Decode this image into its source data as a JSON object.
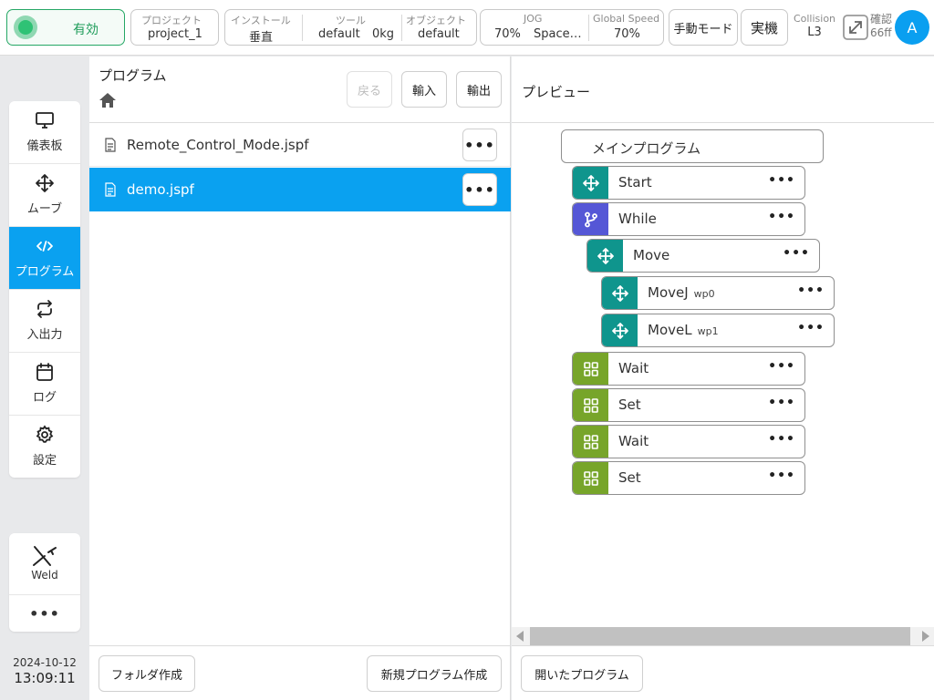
{
  "topbar": {
    "enable": {
      "label": "有効"
    },
    "project": {
      "label": "プロジェクト",
      "value": "project_1"
    },
    "install": {
      "label": "インストール",
      "value": "垂直"
    },
    "tool": {
      "label": "ツール",
      "name": "default",
      "weight": "0kg"
    },
    "object": {
      "label": "オブジェクト",
      "value": "default"
    },
    "jog": {
      "label": "JOG",
      "percent": "70%",
      "space": "Space…"
    },
    "global_speed": {
      "label": "Global Speed",
      "value": "70%"
    },
    "manual_mode": "手動モード",
    "real_machine": "実機",
    "collision": {
      "label": "Collision",
      "value": "L3"
    },
    "confirm": {
      "label": "確認",
      "value": "66ff"
    },
    "avatar": "A"
  },
  "nav": {
    "items": [
      {
        "label": "儀表板",
        "icon": "monitor-icon"
      },
      {
        "label": "ムーブ",
        "icon": "move-icon"
      },
      {
        "label": "プログラム",
        "icon": "code-icon",
        "active": true
      },
      {
        "label": "入出力",
        "icon": "swap-icon"
      },
      {
        "label": "ログ",
        "icon": "calendar-icon"
      },
      {
        "label": "設定",
        "icon": "gear-icon"
      }
    ],
    "weld": "Weld",
    "more": "•••"
  },
  "datetime": {
    "date": "2024-10-12",
    "time": "13:09:11"
  },
  "program": {
    "title": "プログラム",
    "back": "戻る",
    "import": "輸入",
    "export": "輸出",
    "files": [
      {
        "name": "Remote_Control_Mode.jspf",
        "selected": false
      },
      {
        "name": "demo.jspf",
        "selected": true
      }
    ],
    "more": "•••",
    "new_folder": "フォルダ作成",
    "new_program": "新規プログラム作成"
  },
  "preview": {
    "title": "プレビュー",
    "main_program": "メインプログラム",
    "nodes": [
      {
        "label": "Start",
        "sub": "",
        "color": "#0f958d",
        "icon": "move-icon"
      },
      {
        "label": "While",
        "sub": "",
        "color": "#5557d6",
        "icon": "branch-icon"
      },
      {
        "label": "Move",
        "sub": "",
        "color": "#0f958d",
        "icon": "move-icon"
      },
      {
        "label": "MoveJ",
        "sub": "wp0",
        "color": "#0f958d",
        "icon": "move-icon"
      },
      {
        "label": "MoveL",
        "sub": "wp1",
        "color": "#0f958d",
        "icon": "move-icon"
      },
      {
        "label": "Wait",
        "sub": "",
        "color": "#77a52a",
        "icon": "grid-icon"
      },
      {
        "label": "Set",
        "sub": "",
        "color": "#77a52a",
        "icon": "grid-icon"
      },
      {
        "label": "Wait",
        "sub": "",
        "color": "#77a52a",
        "icon": "grid-icon"
      },
      {
        "label": "Set",
        "sub": "",
        "color": "#77a52a",
        "icon": "grid-icon"
      }
    ],
    "node_more": "•••",
    "opened_program": "開いたプログラム"
  }
}
